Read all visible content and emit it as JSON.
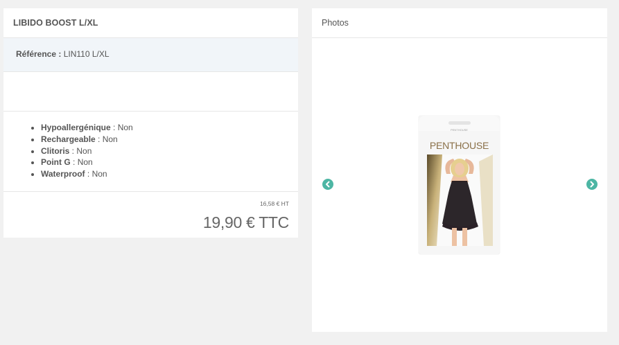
{
  "product": {
    "title": "LIBIDO BOOST L/XL",
    "reference_label": "Référence :",
    "reference_value": "LIN110 L/XL",
    "features": [
      {
        "label": "Hypoallergénique",
        "sep": " : ",
        "value": "Non"
      },
      {
        "label": "Rechargeable",
        "sep": " : ",
        "value": "Non"
      },
      {
        "label": "Clitoris",
        "sep": " : ",
        "value": "Non"
      },
      {
        "label": "Point G",
        "sep": " : ",
        "value": "Non"
      },
      {
        "label": "Waterproof",
        "sep": " : ",
        "value": "Non"
      }
    ],
    "price_ht": "16,58 € HT",
    "price_ttc": "19,90 € TTC"
  },
  "photos": {
    "title": "Photos",
    "prev_icon": "chevron-left-icon",
    "next_icon": "chevron-right-icon",
    "pack_small_text": "PENTHOUSE",
    "pack_brand": "PENTHOUSE"
  },
  "colors": {
    "nav_accent": "#4db6a4",
    "ref_row_bg": "#f1f5f9",
    "brand_gold": "#8a7048"
  }
}
